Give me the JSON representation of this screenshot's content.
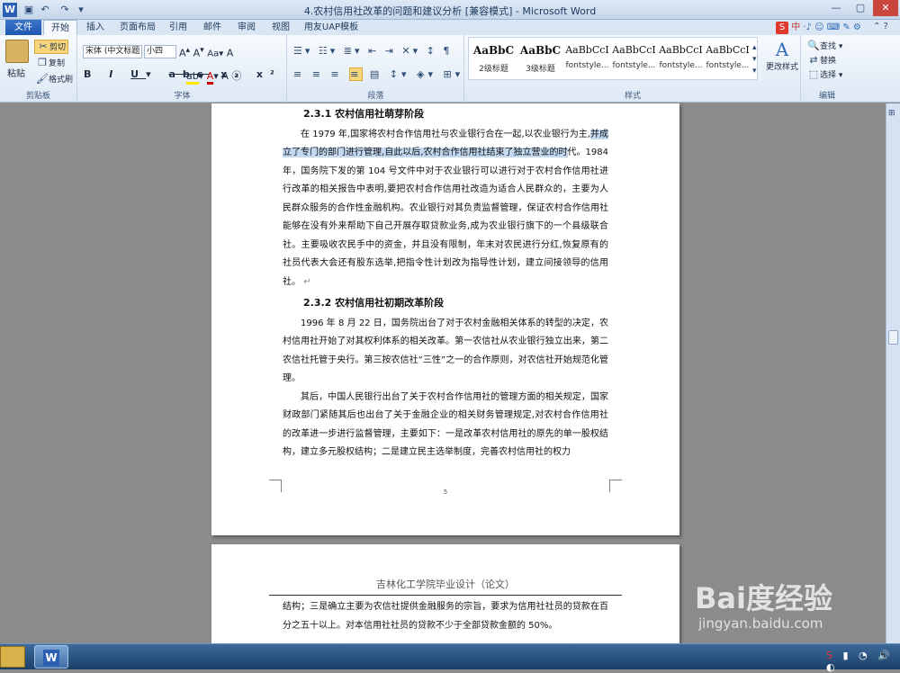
{
  "window": {
    "title": "4.农村信用社改革的问题和建议分析 [兼容模式] - Microsoft Word"
  },
  "tabs": [
    "文件",
    "开始",
    "插入",
    "页面布局",
    "引用",
    "邮件",
    "审阅",
    "视图",
    "用友UAP模板"
  ],
  "clipboard": {
    "paste": "粘贴",
    "cut": "剪切",
    "copy": "复制",
    "format_painter": "格式刷",
    "label": "剪贴板"
  },
  "font": {
    "name": "宋体 (中文标题",
    "size": "小四",
    "label": "字体",
    "buttons": [
      "B",
      "I",
      "U",
      "abe",
      "x₂",
      "x²",
      "A",
      "A"
    ]
  },
  "paragraph": {
    "label": "段落"
  },
  "styles": {
    "label": "样式",
    "items": [
      {
        "preview": "AaBbC",
        "name": "2级标题"
      },
      {
        "preview": "AaBbC",
        "name": "3级标题"
      },
      {
        "preview": "AaBbCcI",
        "name": "fontstyle..."
      },
      {
        "preview": "AaBbCcI",
        "name": "fontstyle..."
      },
      {
        "preview": "AaBbCcI",
        "name": "fontstyle..."
      },
      {
        "preview": "AaBbCcI",
        "name": "fontstyle..."
      }
    ],
    "change": "更改样式"
  },
  "editing": {
    "label": "编辑",
    "find": "查找",
    "replace": "替换",
    "select": "选择"
  },
  "ime": {
    "label": "中"
  },
  "page1": {
    "h1": "2.3.1    农村信用社萌芽阶段",
    "p1a": "在 1979 年,国家将农村合作信用社与农业银行合在一起,以农业银行为主,",
    "p1b": "并成立了专门的部门进行管理,自此以后,农村合作信用社结束了独立营业的时",
    "p1c": "代。1984 年，国务院下发的第 104 号文件中对于农业银行可以进行对于农村合作信用社进行改革的相关报告中表明,要把农村合作信用社改造为适合人民群众的，主要为人民群众服务的合作性金融机构。农业银行对其负责监督管理，保证农村合作信用社能够在没有外来帮助下自己开展存取贷款业务,成为农业银行旗下的一个县级联合社。主要吸收农民手中的资金，并且没有限制，年末对农民进行分红,恢复原有的社员代表大会还有股东选举,把指令性计划改为指导性计划，建立间接领导的信用社。",
    "h2": "2.3.2    农村信用社初期改革阶段",
    "p2": "1996 年 8 月 22 日，国务院出台了对于农村金融相关体系的转型的决定，农村信用社开始了对其权利体系的相关改革。第一农信社从农业银行独立出来，第二农信社托管于央行。第三按农信社“三性”之一的合作原则，对农信社开始规范化管理。",
    "p3": "其后，中国人民银行出台了关于农村合作信用社的管理方面的相关规定，国家财政部门紧随其后也出台了关于金融企业的相关财务管理规定,对农村合作信用社的改革进一步进行监督管理，主要如下：一是改革农村信用社的原先的单一股权结构，建立多元股权结构；二是建立民主选举制度，完善农村信用社的权力",
    "page_number": "5"
  },
  "page2": {
    "header": "吉林化工学院毕业设计（论文）",
    "p1": "结构；三是确立主要为农信社提供金融服务的宗旨，要求为信用社社员的贷款在百分之五十以上。对本信用社社员的贷款不少于全部贷款金额的 50%。"
  },
  "watermark": {
    "brand": "Bai度经验",
    "url": "jingyan.baidu.com"
  }
}
